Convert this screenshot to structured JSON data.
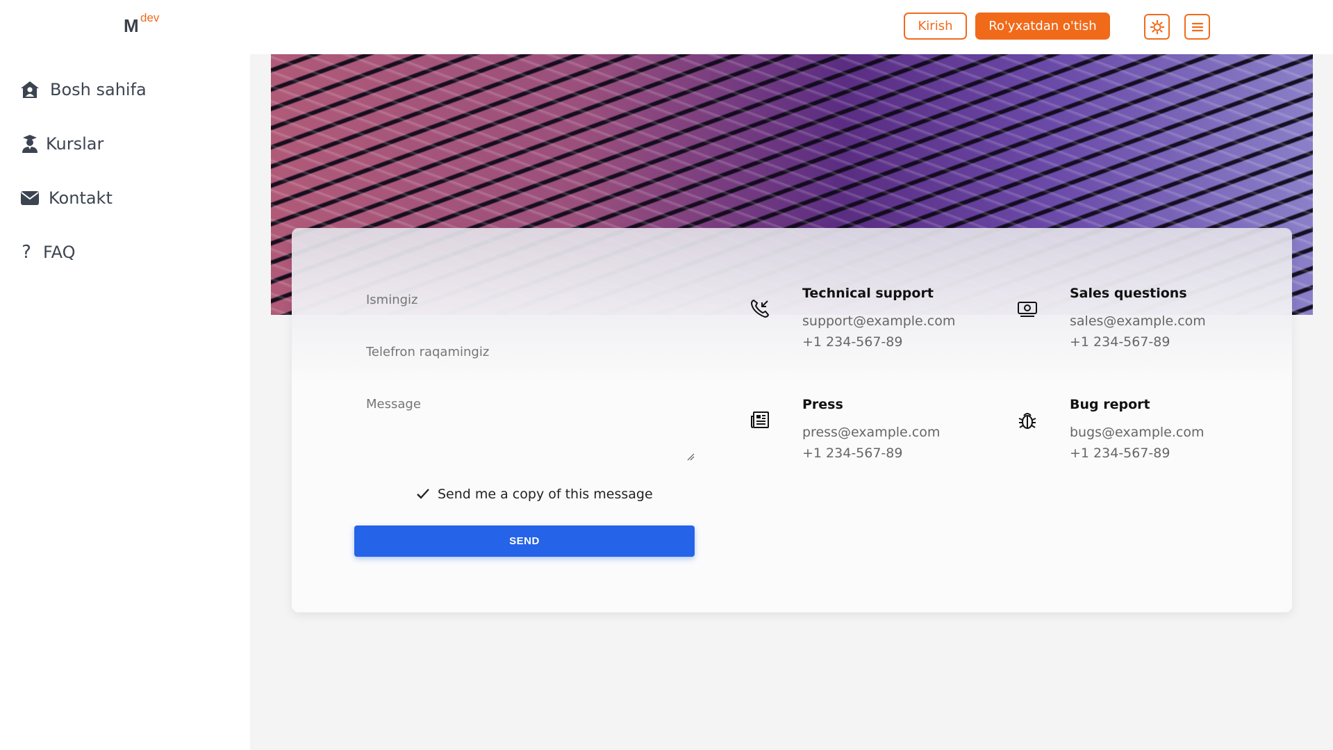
{
  "brand": {
    "logo_main": "M",
    "logo_sup": "dev",
    "accent": "#f06a1a"
  },
  "header": {
    "login_label": "Kirish",
    "register_label": "Ro'yxatdan o'tish",
    "theme_icon": "sun-gear-icon",
    "menu_icon": "hamburger-icon"
  },
  "sidebar": {
    "items": [
      {
        "label": "Bosh sahifa",
        "icon": "home-user-icon"
      },
      {
        "label": "Kurslar",
        "icon": "graduate-icon"
      },
      {
        "label": "Kontakt",
        "icon": "envelope-icon"
      },
      {
        "label": "FAQ",
        "icon": "question-icon"
      }
    ]
  },
  "form": {
    "name_placeholder": "Ismingiz",
    "phone_placeholder": "Telefron raqamingiz",
    "message_placeholder": "Message",
    "copy_label": "Send me a copy of this message",
    "copy_checked": true,
    "send_label": "SEND",
    "send_color": "#2563e8"
  },
  "contacts": [
    {
      "title": "Technical support",
      "email": "support@example.com",
      "phone": "+1 234-567-89",
      "icon": "phone-incoming-icon"
    },
    {
      "title": "Sales questions",
      "email": "sales@example.com",
      "phone": "+1 234-567-89",
      "icon": "money-icon"
    },
    {
      "title": "Press",
      "email": "press@example.com",
      "phone": "+1 234-567-89",
      "icon": "newspaper-icon"
    },
    {
      "title": "Bug report",
      "email": "bugs@example.com",
      "phone": "+1 234-567-89",
      "icon": "bug-icon"
    }
  ]
}
